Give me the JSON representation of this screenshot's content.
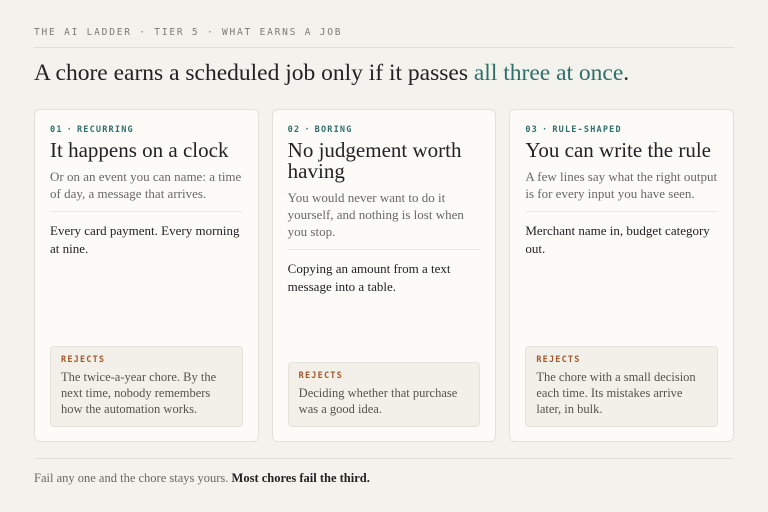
{
  "eyebrow": "THE AI LADDER · TIER 5 · WHAT EARNS A JOB",
  "headline": {
    "lead": "A chore earns a scheduled job only if it passes ",
    "accent": "all three at once",
    "end": "."
  },
  "colors": {
    "accent": "#2f6f6a",
    "rejects": "#a2562c",
    "background": "#f4f2ed"
  },
  "cards": [
    {
      "number": "01",
      "separator": "·",
      "tag": "RECURRING",
      "title": "It happens on a clock",
      "description": "Or on an event you can name: a time of day, a message that arrives.",
      "example": "Every card payment. Every morning at nine.",
      "rejects_label": "REJECTS",
      "rejects_text": "The twice-a-year chore. By the next time, nobody remembers how the automation works."
    },
    {
      "number": "02",
      "separator": "·",
      "tag": "BORING",
      "title": "No judgement worth having",
      "description": "You would never want to do it yourself, and nothing is lost when you stop.",
      "example": "Copying an amount from a text message into a table.",
      "rejects_label": "REJECTS",
      "rejects_text": "Deciding whether that purchase was a good idea."
    },
    {
      "number": "03",
      "separator": "·",
      "tag": "RULE-SHAPED",
      "title": "You can write the rule",
      "description": "A few lines say what the right output is for every input you have seen.",
      "example": "Merchant name in, budget category out.",
      "rejects_label": "REJECTS",
      "rejects_text": "The chore with a small decision each time. Its mistakes arrive later, in bulk."
    }
  ],
  "footer": {
    "text": "Fail any one and the chore stays yours. ",
    "emphasis": "Most chores fail the third."
  }
}
